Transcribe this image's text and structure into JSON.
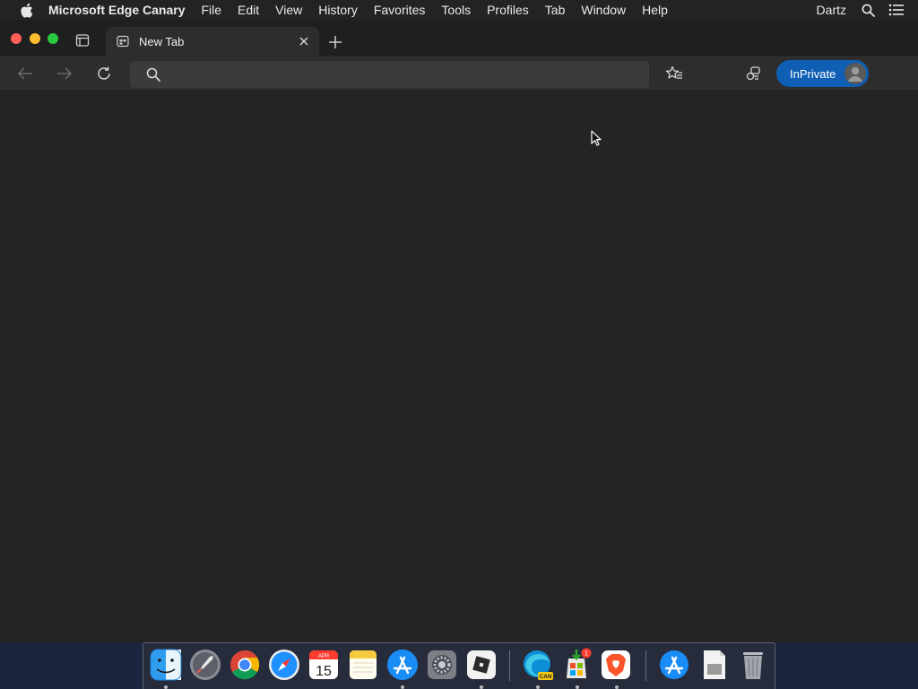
{
  "menubar": {
    "app_name": "Microsoft Edge Canary",
    "items": [
      "File",
      "Edit",
      "View",
      "History",
      "Favorites",
      "Tools",
      "Profiles",
      "Tab",
      "Window",
      "Help"
    ],
    "user": "Dartz",
    "icons": [
      "apple-icon",
      "spotlight-search-icon",
      "control-center-icon"
    ]
  },
  "tabs": [
    {
      "title": "New Tab",
      "active": true
    }
  ],
  "toolbar": {
    "address_value": "",
    "address_placeholder": "",
    "inprivate_label": "InPrivate"
  },
  "dock": {
    "apps": [
      {
        "name": "Finder",
        "running": true
      },
      {
        "name": "Launchpad",
        "running": false
      },
      {
        "name": "Google Chrome",
        "running": false
      },
      {
        "name": "Safari",
        "running": false
      },
      {
        "name": "Calendar",
        "running": false,
        "month": "APR",
        "day": "15"
      },
      {
        "name": "Notes",
        "running": false
      },
      {
        "name": "App Store",
        "running": true
      },
      {
        "name": "System Preferences",
        "running": false
      },
      {
        "name": "Roblox",
        "running": true
      },
      {
        "name": "Microsoft Edge Canary",
        "running": true,
        "badge_text": "CAN"
      },
      {
        "name": "Microsoft Store Installer",
        "running": true,
        "badge": "1"
      },
      {
        "name": "Brave Browser",
        "running": true
      },
      {
        "name": "App Store Folder",
        "running": false
      },
      {
        "name": "Document Preview",
        "running": false
      },
      {
        "name": "Trash",
        "running": false
      }
    ]
  },
  "colors": {
    "menubar_bg": "#232323",
    "window_bg": "#242424",
    "toolbar_bg": "#2d2d2d",
    "inprivate_accent": "#0f5fb5",
    "close": "#fe5f57",
    "minimize": "#febc2e",
    "maximize": "#28c840"
  }
}
